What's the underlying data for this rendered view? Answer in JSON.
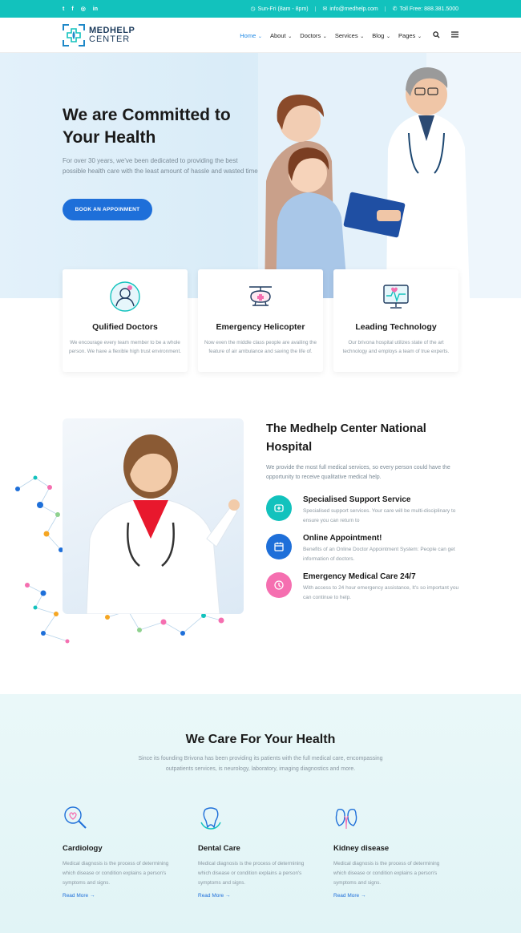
{
  "topbar": {
    "social": [
      "t",
      "f",
      "◎",
      "in"
    ],
    "hours": "Sun-Fri (8am - 8pm)",
    "email": "info@medhelp.com",
    "phone": "Toll Free: 888.381.5000"
  },
  "brand": {
    "line1": "MEDHELP",
    "line2": "CENTER",
    "color": "#1e88c8"
  },
  "nav": {
    "items": [
      "Home",
      "About",
      "Doctors",
      "Services",
      "Blog",
      "Pages"
    ],
    "active": "Home"
  },
  "hero": {
    "title": "We are Committed to Your Health",
    "text": "For over 30 years, we've been dedicated to providing the best possible health care with the least amount of hassle and wasted time.",
    "cta": "BOOK AN APPOINMENT"
  },
  "features": [
    {
      "icon": "doctor-icon",
      "title": "Qulified Doctors",
      "text": "We encourage every team member to be a whole person. We have a flexible high trust environment."
    },
    {
      "icon": "helicopter-icon",
      "title": "Emergency Helicopter",
      "text": "Now even the middle class people are availing the feature of air ambulance and saving the life of."
    },
    {
      "icon": "monitor-icon",
      "title": "Leading Technology",
      "text": "Our brivona hospital utilizes state of the art technology and employs a team of true experts."
    }
  ],
  "about": {
    "title": "The Medhelp Center National Hospital",
    "text": "We provide the most full medical services, so every person could have the opportunity to receive qualitative medical help.",
    "services": [
      {
        "title": "Specialised Support Service",
        "text": "Specialised support services. Your care will be multi-disciplinary to ensure you can return to",
        "color": "#12c2bd"
      },
      {
        "title": "Online Appointment!",
        "text": "Benefits of an Online Doctor Appointment System: People can get information of doctors.",
        "color": "#1e6fd9"
      },
      {
        "title": "Emergency Medical Care 24/7",
        "text": "With access to 24 hour emergency assistance, It's so important you can continue to help.",
        "color": "#f56fb0"
      }
    ]
  },
  "care": {
    "title": "We Care For Your Health",
    "text": "Since its founding Brivona has been providing its patients with the full medical care, encompassing outpatients services, is neurology, laboratory, imaging diagnostics and more.",
    "columns": [
      {
        "icon": "cardiology-icon",
        "title": "Cardiology",
        "text": "Medical diagnosis is the process of determining which disease or condition explains a person's symptoms and signs.",
        "more": "Read More →"
      },
      {
        "icon": "tooth-icon",
        "title": "Dental Care",
        "text": "Medical diagnosis is the process of determining which disease or condition explains a person's symptoms and signs.",
        "more": "Read More →"
      },
      {
        "icon": "kidney-icon",
        "title": "Kidney disease",
        "text": "Medical diagnosis is the process of determining which disease or condition explains a person's symptoms and signs.",
        "more": "Read More →"
      }
    ]
  }
}
